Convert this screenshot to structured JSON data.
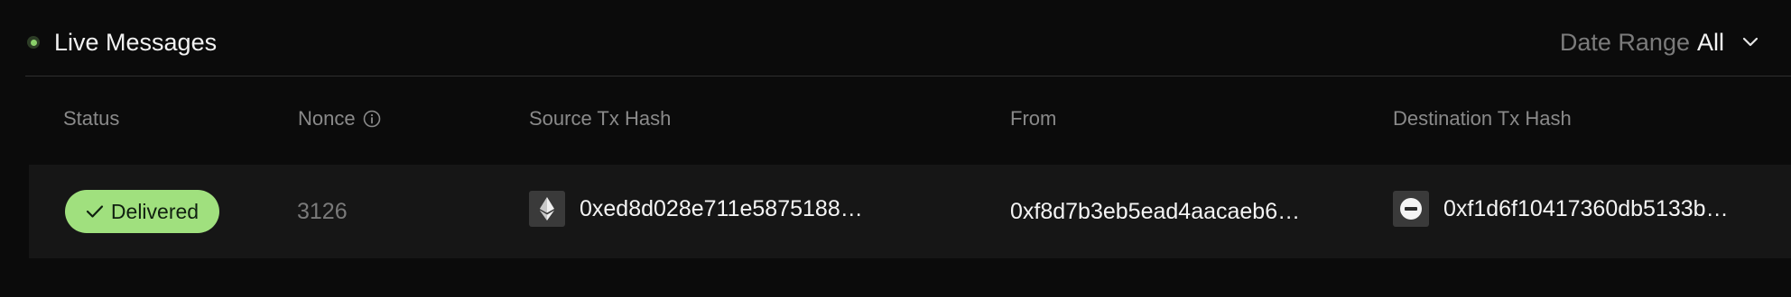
{
  "header": {
    "title": "Live Messages",
    "date_range_label": "Date Range",
    "date_range_value": "All"
  },
  "columns": {
    "status": "Status",
    "nonce": "Nonce",
    "source_tx_hash": "Source Tx Hash",
    "from": "From",
    "destination_tx_hash": "Destination Tx Hash"
  },
  "rows": [
    {
      "status": "Delivered",
      "nonce": "3126",
      "source_tx_hash": "0xed8d028e711e5875188…",
      "source_chain_icon": "ethereum-icon",
      "from": "0xf8d7b3eb5ead4aacaeb6…",
      "destination_tx_hash": "0xf1d6f10417360db5133b…",
      "destination_chain_icon": "minus-circle-chain-icon"
    }
  ],
  "colors": {
    "background": "#0b0b0b",
    "row_background": "#161616",
    "status_delivered": "#a0e07e",
    "live_indicator": "#8ad06a"
  }
}
